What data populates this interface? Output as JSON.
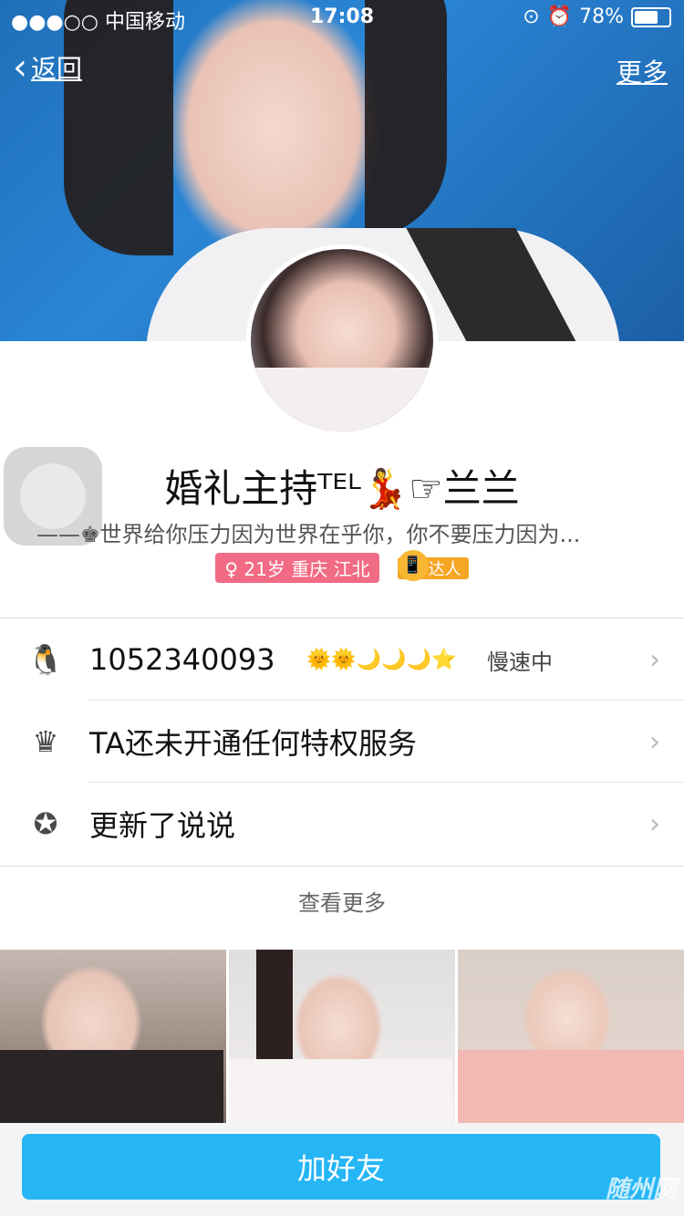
{
  "status_bar": {
    "carrier": "●●●○○ 中国移动",
    "time": "17:08",
    "battery": "78%",
    "battery_fraction": 0.78
  },
  "nav": {
    "back_label": "返回",
    "more_label": "更多"
  },
  "profile": {
    "name": "婚礼主持ᵀᴱᴸ💃☞兰兰",
    "signature": "——♚世界给你压力因为世界在乎你，你不要压力因为...",
    "info_badge": "21岁 重庆 江北",
    "expert_badge": "达人"
  },
  "rows": [
    {
      "icon": "penguin-icon",
      "text": "1052340093",
      "levels": "🌞🌞🌙🌙🌙⭐",
      "status": "慢速中"
    },
    {
      "icon": "crown-icon",
      "text": "TA还未开通任何特权服务"
    },
    {
      "icon": "qzone-star-icon",
      "text": "更新了说说"
    }
  ],
  "see_more": "查看更多",
  "add_friend": "加好友",
  "watermark": "随州网",
  "colors": {
    "accent": "#27b6f5",
    "badge_pink": "#f26b84",
    "badge_orange": "#f5a623"
  }
}
